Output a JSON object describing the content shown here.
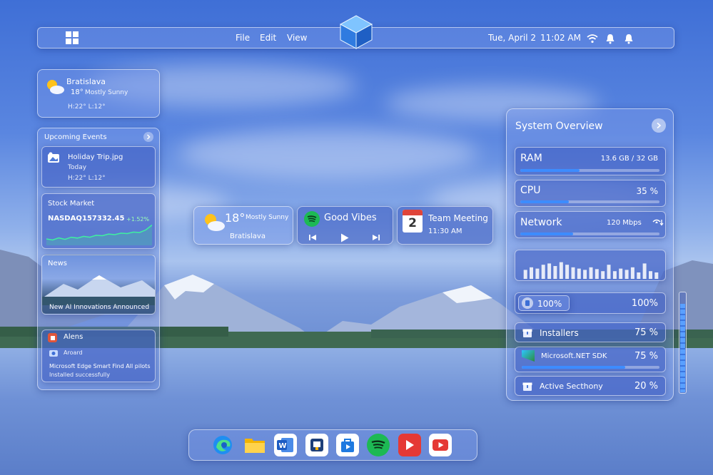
{
  "menubar": {
    "file": "File",
    "edit": "Edit",
    "view": "View",
    "date": "Tue, April 2",
    "time": "11:02 AM"
  },
  "weather_widget": {
    "city": "Bratislava",
    "temp": "18°",
    "condition": "Mostly Sunny",
    "hilo": "H:22°  L:12°"
  },
  "events": {
    "title": "Upcoming Events",
    "item_title": "Holiday Trip.jpg",
    "item_when": "Today",
    "item_hilo": "H:22°  L:12°"
  },
  "stock": {
    "title": "Stock Market",
    "label": "NASDAQ",
    "value": "157332.45",
    "change": "+1.52%",
    "trend": [
      0.3,
      0.25,
      0.35,
      0.28,
      0.38,
      0.34,
      0.42,
      0.38,
      0.47,
      0.45,
      0.53,
      0.5,
      0.57,
      0.55,
      0.62,
      0.6,
      0.72,
      0.95
    ]
  },
  "news": {
    "title": "News",
    "headline": "New AI Innovations Announced"
  },
  "alerts": {
    "title": "Alens",
    "sub": "Aroard",
    "line1": "Microsoft Edge  Smart Find All pilots",
    "line2": "Installed successfully"
  },
  "mini_weather": {
    "temp": "18°",
    "condition": "Mostly Sunny",
    "city": "Bratislava"
  },
  "music": {
    "title": "Good Vibes"
  },
  "calendar": {
    "day": "2",
    "title": "Team Meeting",
    "time": "11:30 AM"
  },
  "system": {
    "title": "System Overview",
    "ram": {
      "label": "RAM",
      "value": "13.6 GB / 32 GB",
      "fraction": 0.425
    },
    "cpu": {
      "label": "CPU",
      "value": "35 %",
      "fraction": 0.35
    },
    "network": {
      "label": "Network",
      "value": "120 Mbps",
      "fraction": 0.38
    },
    "graph": [
      0.35,
      0.45,
      0.4,
      0.55,
      0.6,
      0.5,
      0.65,
      0.55,
      0.45,
      0.4,
      0.35,
      0.45,
      0.38,
      0.3,
      0.55,
      0.3,
      0.4,
      0.35,
      0.45,
      0.25,
      0.6,
      0.3,
      0.25
    ],
    "storage": {
      "left": "100%",
      "right": "100%"
    },
    "installers": {
      "label": "Installers",
      "value": "75 %"
    },
    "netsdk": {
      "label": "Microsoft.NET SDK",
      "value": "75 %",
      "fraction": 0.75
    },
    "active": {
      "label": "Active Secthony",
      "value": "20 %"
    },
    "scroll_fraction": 0.88
  },
  "colors": {
    "accent": "#3d8cff",
    "glass": "#7896e6"
  }
}
